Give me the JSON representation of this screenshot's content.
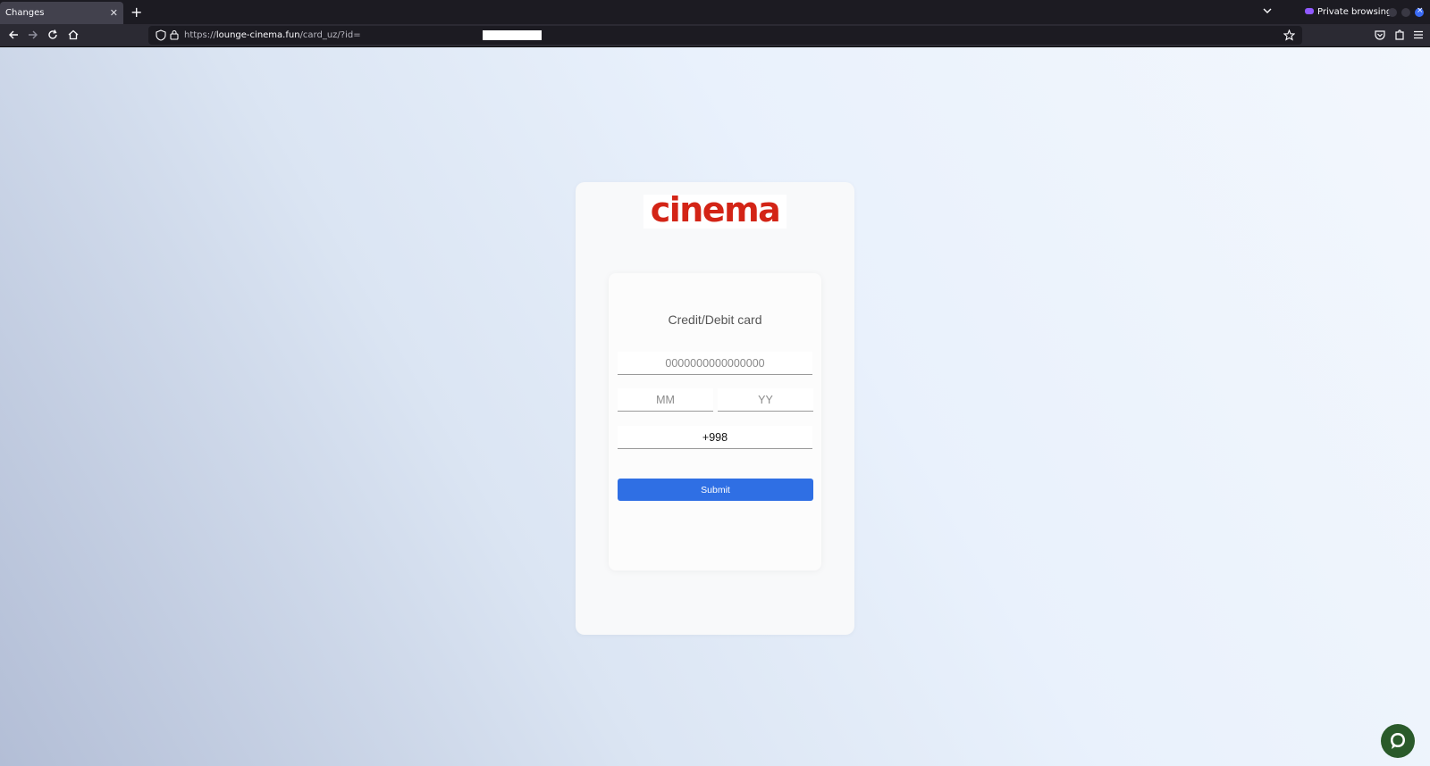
{
  "browser": {
    "tab_title": "Changes",
    "private_label": "Private browsing",
    "url_prefix": "https://",
    "url_host": "lounge-cinema.fun",
    "url_path": "/card_uz/?id="
  },
  "logo": {
    "text": "cinema"
  },
  "form": {
    "title": "Credit/Debit card",
    "card_number_placeholder": "0000000000000000",
    "month_placeholder": "MM",
    "year_placeholder": "YY",
    "phone_value": "+998",
    "submit_label": "Submit"
  },
  "colors": {
    "accent": "#2f6fe4",
    "logo": "#d32416",
    "chat": "#2a5a2a"
  },
  "icons": [
    "close-icon",
    "plus-icon",
    "chevron-down-icon",
    "back-icon",
    "forward-icon",
    "reload-icon",
    "home-icon",
    "shield-icon",
    "lock-icon",
    "star-icon",
    "pocket-icon",
    "extensions-icon",
    "menu-icon",
    "chat-icon"
  ]
}
